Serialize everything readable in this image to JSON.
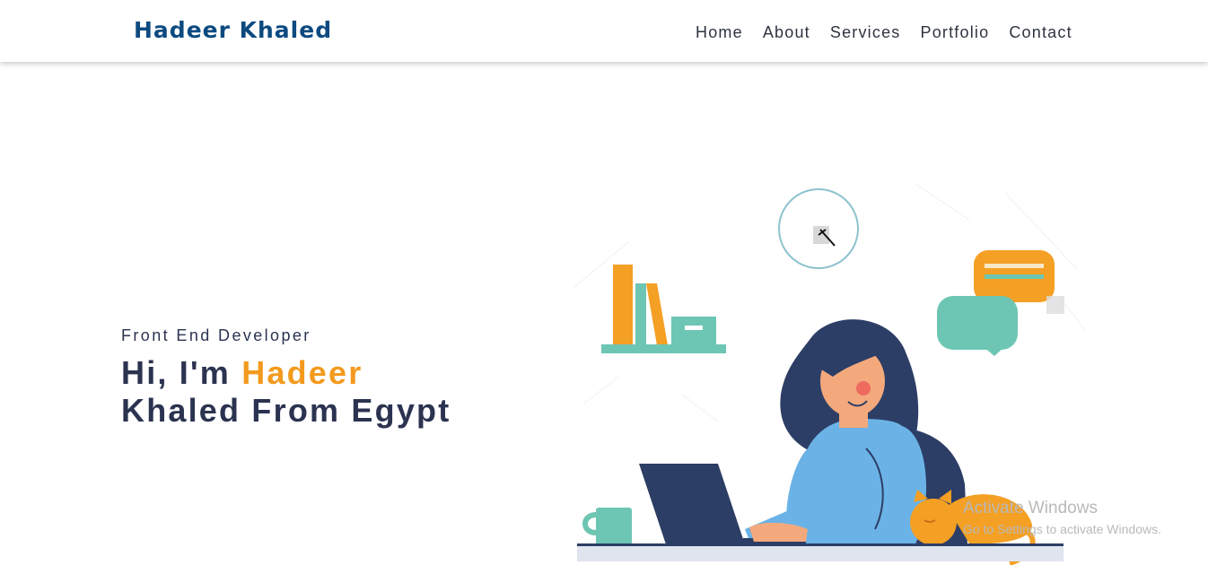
{
  "navbar": {
    "brand": "Hadeer Khaled",
    "links": [
      {
        "label": "Home"
      },
      {
        "label": "About"
      },
      {
        "label": "Services"
      },
      {
        "label": "Portfolio"
      },
      {
        "label": "Contact"
      }
    ]
  },
  "hero": {
    "subtitle": "Front End Developer",
    "greeting_prefix": "Hi, I'm ",
    "highlight_name": "Hadeer",
    "headline_line2": "Khaled From Egypt",
    "accent_color": "#f39a1e",
    "text_color": "#2b3350",
    "brand_color": "#0d4a80"
  },
  "watermark": {
    "title": "Activate Windows",
    "subtitle": "Go to Settings to activate Windows."
  }
}
